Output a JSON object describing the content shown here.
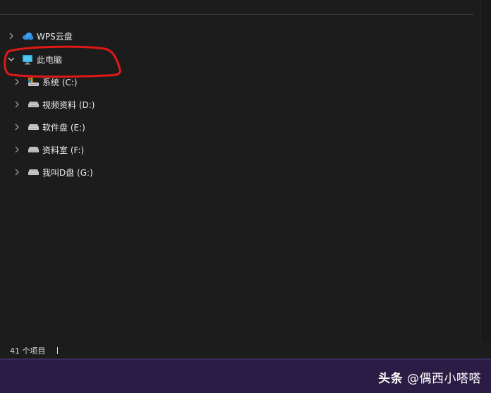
{
  "nav_tree": {
    "wps_cloud": {
      "label": "WPS云盘",
      "icon": "cloud-icon"
    },
    "this_pc": {
      "label": "此电脑",
      "icon": "monitor-icon",
      "expanded": true
    },
    "drives": [
      {
        "label": "系统 (C:)",
        "icon": "system-drive-icon"
      },
      {
        "label": "视频资料 (D:)",
        "icon": "drive-icon"
      },
      {
        "label": "软件盘 (E:)",
        "icon": "drive-icon"
      },
      {
        "label": "资料室 (F:)",
        "icon": "drive-icon"
      },
      {
        "label": "我叫D盘 (G:)",
        "icon": "drive-icon"
      }
    ]
  },
  "status_bar": {
    "item_count": "41 个项目"
  },
  "watermark": {
    "brand": "头条",
    "author": "@偶西小嗒嗒"
  },
  "colors": {
    "background": "#1c1c1c",
    "annotation_circle": "#e01818",
    "monitor_icon": "#29a8e0",
    "cloud_icon": "#2f8de4",
    "bottom_band": "#2b1c45"
  }
}
